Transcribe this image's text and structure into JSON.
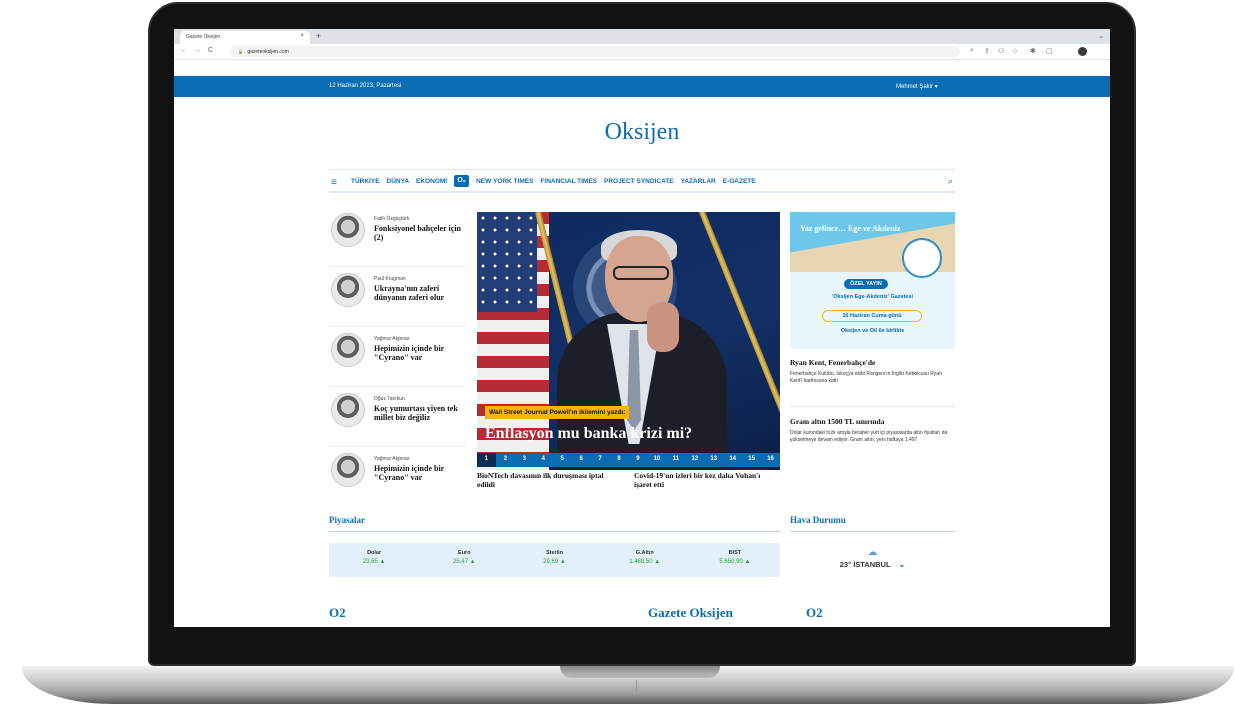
{
  "browser": {
    "tab_title": "Gazete Oksijen",
    "tab_close": "×",
    "new_tab": "+",
    "menu": "⌄",
    "back": "←",
    "forward": "→",
    "reload": "C",
    "lock": "🔒",
    "url": "gazeteoksijen.com",
    "ext_icons": [
      "⌕",
      "⇪",
      "⚇",
      "☆",
      "✱",
      "▢"
    ]
  },
  "site": {
    "date": "12 Haziran 2023, Pazartesi",
    "user": "Mehmet Şakir ▾",
    "logo": "Oksijen",
    "nav": {
      "burger": "≡",
      "items": [
        "TÜRKİYE",
        "DÜNYA",
        "EKONOMİ",
        "O₂",
        "NEW YORK TIMES",
        "FINANCIAL TIMES",
        "PROJECT SYNDICATE",
        "YAZARLAR",
        "E-GAZETE"
      ],
      "search": "⌕"
    },
    "authors": [
      {
        "name": "Fatih Özgüçtürk",
        "title": "Fonksiyonel bahçeler için (2)"
      },
      {
        "name": "Paul Krugman",
        "title": "Ukrayna'nın zaferi dünyanın zaferi olur"
      },
      {
        "name": "Yağmur Akpınar",
        "title": "Hepimizin içinde bir \"Cyrano\" var"
      },
      {
        "name": "Oğuz Tanıkun",
        "title": "Koç yumurtası yiyen tek millet biz değiliz"
      },
      {
        "name": "Yağmur Akpınar",
        "title": "Hepimizin içinde bir \"Cyrano\" var"
      }
    ],
    "hero": {
      "kicker": "Wall Street Journal Powell'ın ikilemini yazdı:",
      "headline": "Enflasyon mu banka krizi mi?",
      "pages": [
        "1",
        "2",
        "3",
        "4",
        "5",
        "6",
        "7",
        "8",
        "9",
        "10",
        "11",
        "12",
        "13",
        "14",
        "15",
        "16"
      ],
      "active_page": "1"
    },
    "subheads": [
      "BioNTech davasının ilk duruşması iptal edildi",
      "Covid-19'un izleri bir kez daha Vuhan'ı işaret etti"
    ],
    "ad": {
      "title": "Yaz gelince… Ege ve Akdeniz",
      "pill": "ÖZEL YAYIN",
      "line1": "'Oksijen Ege-Akdeniz' Gazetesi",
      "line2": "16 Haziran Cuma günü",
      "line3": "Oksijen ve Oil ile birlikte"
    },
    "news": [
      {
        "title": "Ryan Kent, Fenerbahçe'de",
        "text": "Fenerbahçe Kulübü, İskoçya ekibi Rangers'ın İngiliz futbolcusu Ryan Kent'i kadrosuna kattı"
      },
      {
        "title": "Gram altın 1500 TL sınırında",
        "text": "Dolar kurundaki hızlı artışla beraber yurt içi piyasalarda altın fiyatları da yükselmeye devam ediyor. Gram altın, yeni haftaya 1.497"
      }
    ],
    "markets_title": "Piyasalar",
    "markets": [
      {
        "label": "Dolar",
        "value": "23,65 ▲"
      },
      {
        "label": "Euro",
        "value": "25,47 ▲"
      },
      {
        "label": "Sterlin",
        "value": "29,69 ▲"
      },
      {
        "label": "G.Altın",
        "value": "1.488,50 ▲"
      },
      {
        "label": "BIST",
        "value": "5.650,90 ▲"
      }
    ],
    "weather_title": "Hava Durumu",
    "weather": {
      "icon": "☁",
      "text": "23° İSTANBUL",
      "chevron": "⌄"
    },
    "footer_left": "O2",
    "footer_center": "Gazete Oksijen",
    "footer_right": "O2"
  },
  "colors": {
    "brand": "#0a6db3",
    "kicker": "#f7b400",
    "up": "#2aa336"
  }
}
